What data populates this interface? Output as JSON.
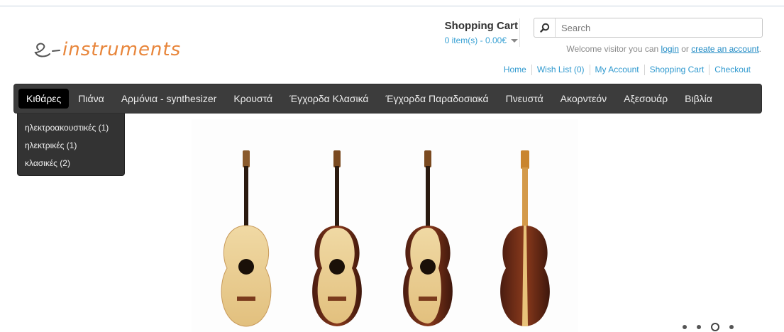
{
  "logo": {
    "text": "e-instruments",
    "color_e": "#555555",
    "color_rest": "#e8853a"
  },
  "cart": {
    "title": "Shopping Cart",
    "summary": "0 item(s) - 0.00€"
  },
  "search": {
    "placeholder": "Search",
    "icon": "magnifier-icon"
  },
  "welcome": {
    "prefix": "Welcome visitor you can",
    "login": "login",
    "or": "or",
    "create": "create an account",
    "suffix": "."
  },
  "toplinks": [
    "Home",
    "Wish List (0)",
    "My Account",
    "Shopping Cart",
    "Checkout"
  ],
  "nav": {
    "items": [
      "Κιθάρες",
      "Πιάνα",
      "Αρμόνια - synthesizer",
      "Κρουστά",
      "Έγχορδα Κλασικά",
      "Έγχορδα Παραδοσιακά",
      "Πνευστά",
      "Ακορντεόν",
      "Αξεσουάρ",
      "Βιβλία"
    ],
    "active_index": 0
  },
  "dropdown": [
    "ηλεκτροακουστικές (1)",
    "ηλεκτρικές (1)",
    "κλασικές (2)"
  ],
  "slider": {
    "image": "four-classical-guitars",
    "dots": 4,
    "active_dot": 2
  },
  "colors": {
    "nav_bg": "#3c3c3c",
    "link": "#2f99cf",
    "active_nav": "#000000"
  }
}
